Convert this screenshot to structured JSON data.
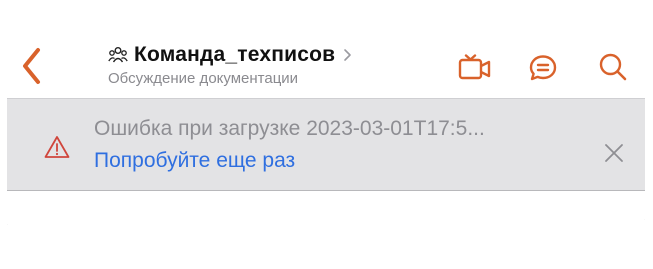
{
  "header": {
    "title": "Команда_техписов",
    "subtitle": "Обсуждение документации",
    "icons": [
      "back-chevron-icon",
      "group-icon",
      "chevron-right-icon",
      "video-call-icon",
      "chat-bubble-icon",
      "search-icon"
    ],
    "accent_color": "#d9622b"
  },
  "banner": {
    "error_text": "Ошибка при загрузке 2023-03-01T17:5...",
    "retry_label": "Попробуйте еще раз",
    "icons": [
      "warning-icon",
      "close-icon"
    ],
    "warning_color": "#d0463c",
    "link_color": "#2f6fe0",
    "background": "#e3e3e5"
  }
}
